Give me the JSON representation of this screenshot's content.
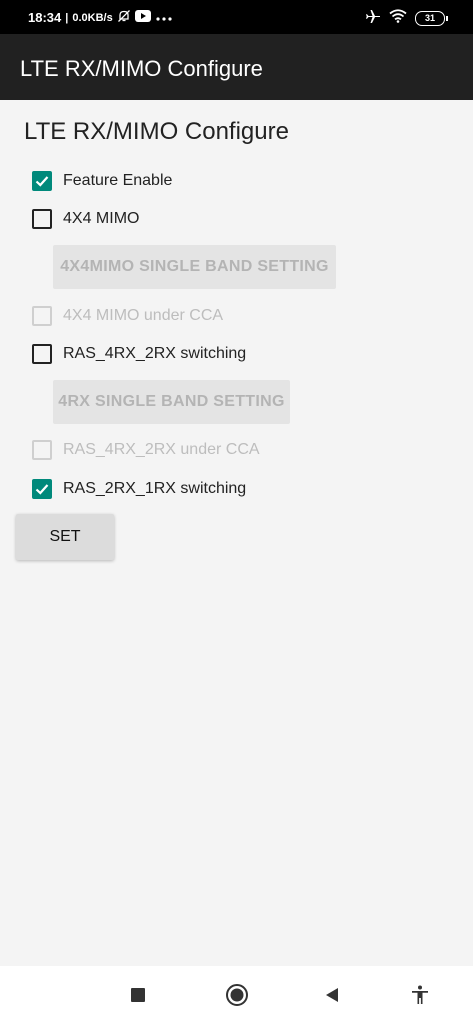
{
  "status_bar": {
    "time": "18:34",
    "network_speed": "0.0KB/s",
    "battery_level": "31",
    "icons": [
      "bell-off-icon",
      "youtube-icon",
      "more-dots-icon",
      "airplane-icon",
      "wifi-icon",
      "battery-icon"
    ]
  },
  "app_bar": {
    "title": "LTE RX/MIMO Configure"
  },
  "content": {
    "heading": "LTE RX/MIMO Configure",
    "options": [
      {
        "label": "Feature Enable",
        "checked": true,
        "enabled": true
      },
      {
        "label": "4X4 MIMO",
        "checked": false,
        "enabled": true
      },
      {
        "label": "4X4 MIMO under CCA",
        "checked": false,
        "enabled": false
      },
      {
        "label": "RAS_4RX_2RX switching",
        "checked": false,
        "enabled": true
      },
      {
        "label": "RAS_4RX_2RX under CCA",
        "checked": false,
        "enabled": false
      },
      {
        "label": "RAS_2RX_1RX switching",
        "checked": true,
        "enabled": true
      }
    ],
    "band_4x4_button": "4X4MIMO SINGLE BAND SETTING",
    "band_4rx_button": "4RX SINGLE BAND SETTING",
    "set_button": "SET"
  },
  "colors": {
    "accent": "#00897b",
    "app_bar": "#212121",
    "background": "#f4f4f4"
  },
  "nav_bar": {
    "icons": [
      "recents-square-icon",
      "home-circle-icon",
      "back-triangle-icon",
      "accessibility-icon"
    ]
  }
}
